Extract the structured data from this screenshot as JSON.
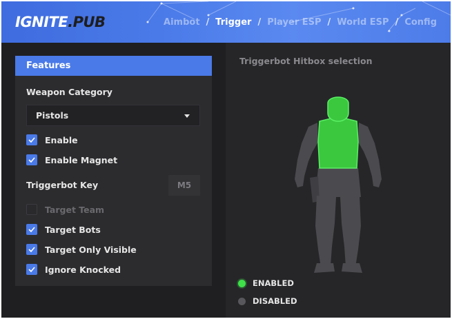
{
  "header": {
    "logo_main": "IGNITE",
    "logo_suffix": ".PUB",
    "tabs": [
      {
        "label": "Aimbot",
        "active": false
      },
      {
        "label": "Trigger",
        "active": true
      },
      {
        "label": "Player ESP",
        "active": false
      },
      {
        "label": "World ESP",
        "active": false
      },
      {
        "label": "Config",
        "active": false
      }
    ],
    "separator": "/"
  },
  "features": {
    "title": "Features",
    "weapon_category_label": "Weapon Category",
    "weapon_category_value": "Pistols",
    "enable_label": "Enable",
    "enable_checked": true,
    "enable_magnet_label": "Enable Magnet",
    "enable_magnet_checked": true,
    "triggerbot_key_label": "Triggerbot Key",
    "triggerbot_key_value": "M5",
    "target_team_label": "Target Team",
    "target_team_checked": false,
    "target_bots_label": "Target Bots",
    "target_bots_checked": true,
    "target_only_visible_label": "Target Only Visible",
    "target_only_visible_checked": true,
    "ignore_knocked_label": "Ignore Knocked",
    "ignore_knocked_checked": true
  },
  "hitbox": {
    "title": "Triggerbot Hitbox selection",
    "enabled_label": "ENABLED",
    "disabled_label": "DISABLED",
    "enabled_color": "#3fe04a",
    "disabled_color": "#58585c",
    "selected_parts": [
      "head",
      "chest"
    ]
  },
  "colors": {
    "accent": "#4a7ae8",
    "panel_left": "#1f1f21",
    "panel_right": "#262629",
    "card": "#2c2c2f"
  }
}
